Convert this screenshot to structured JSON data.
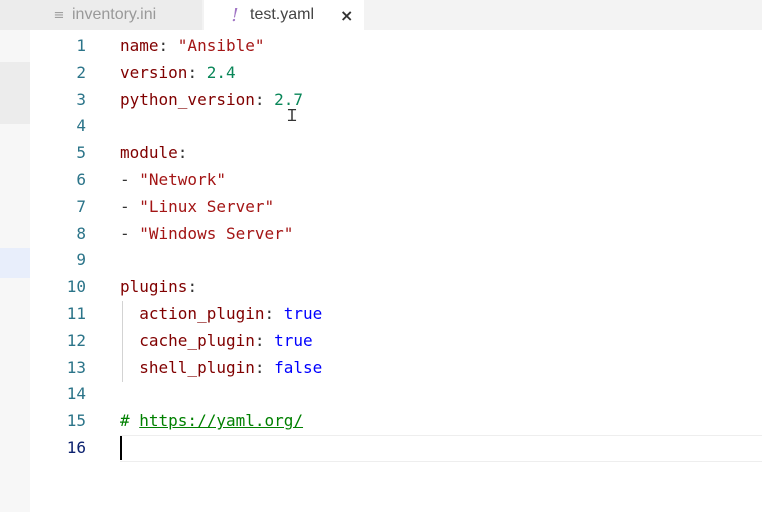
{
  "tabs": [
    {
      "label": "inventory.ini",
      "icon": "lines-icon",
      "active": false
    },
    {
      "label": "test.yaml",
      "icon": "exclamation-icon",
      "active": true,
      "close": "×"
    }
  ],
  "editor": {
    "language": "yaml",
    "current_line": 16,
    "lines": [
      {
        "num": "1",
        "key": "name",
        "sep": ": ",
        "value": "\"Ansible\"",
        "type": "str"
      },
      {
        "num": "2",
        "key": "version",
        "sep": ": ",
        "value": "2.4",
        "type": "num"
      },
      {
        "num": "3",
        "key": "python_version",
        "sep": ": ",
        "value": "2.7",
        "type": "num"
      },
      {
        "num": "4"
      },
      {
        "num": "5",
        "key": "module",
        "sep": ":"
      },
      {
        "num": "6",
        "dash": "- ",
        "value": "\"Network\"",
        "type": "str"
      },
      {
        "num": "7",
        "dash": "- ",
        "value": "\"Linux Server\"",
        "type": "str"
      },
      {
        "num": "8",
        "dash": "- ",
        "value": "\"Windows Server\"",
        "type": "str"
      },
      {
        "num": "9"
      },
      {
        "num": "10",
        "key": "plugins",
        "sep": ":"
      },
      {
        "num": "11",
        "indent": "  ",
        "key": "action_plugin",
        "sep": ": ",
        "value": "true",
        "type": "bool"
      },
      {
        "num": "12",
        "indent": "  ",
        "key": "cache_plugin",
        "sep": ": ",
        "value": "true",
        "type": "bool"
      },
      {
        "num": "13",
        "indent": "  ",
        "key": "shell_plugin",
        "sep": ": ",
        "value": "false",
        "type": "bool"
      },
      {
        "num": "14"
      },
      {
        "num": "15",
        "comment": "# ",
        "url": "https://yaml.org/"
      },
      {
        "num": "16"
      }
    ]
  },
  "colors": {
    "key": "#800000",
    "string": "#a31515",
    "number": "#098658",
    "boolean": "#0000ff",
    "comment": "#008000",
    "line_number": "#2b7489"
  }
}
